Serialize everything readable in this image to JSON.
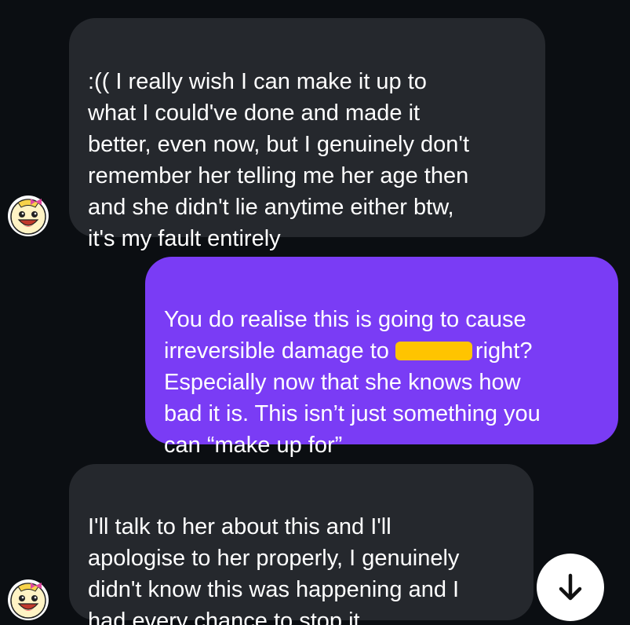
{
  "messages": [
    {
      "direction": "incoming",
      "text": ":(( I really wish I can make it up to\nwhat I could've done and made it\nbetter, even now, but I genuinely don't\nremember her telling me her age then\nand she didn't lie anytime either btw,\nit's my fault entirely"
    },
    {
      "direction": "outgoing",
      "text_before_redaction": "You do realise this is going to cause\nirreversible damage to",
      "text_after_redaction": "right?\nEspecially now that she knows how\nbad it is. This isn’t just something you\ncan “make up for”"
    },
    {
      "direction": "incoming",
      "text": "I'll talk to her about this and I'll\napologise to her properly, I genuinely\ndidn't know this was happening and I\nhad every chance to stop it"
    }
  ],
  "icons": {
    "avatar": "cartoon-face-avatar-icon",
    "scroll_down": "arrow-down-icon"
  },
  "colors": {
    "background": "#0b0e12",
    "incoming_bubble": "#25282d",
    "outgoing_bubble": "#7a3cf5",
    "redaction": "#ffc400",
    "text": "#ffffff"
  }
}
